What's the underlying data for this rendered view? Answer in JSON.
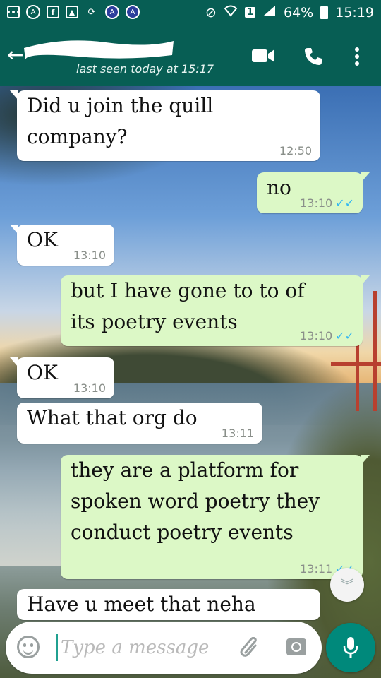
{
  "status_bar": {
    "sim_badge": "1",
    "battery": "64%",
    "time": "15:19",
    "icons": [
      "notification-icon",
      "app-icon",
      "facebook-icon",
      "gallery-icon",
      "sync-icon",
      "app-icon",
      "app-icon",
      "mute-icon",
      "wifi-icon",
      "signal-icon",
      "battery-icon"
    ]
  },
  "header": {
    "back_icon": "arrow-left-icon",
    "last_seen": "last seen today at 15:17",
    "actions": [
      "video-call-icon",
      "phone-icon",
      "more-vert-icon"
    ],
    "accent_color": "#075e54"
  },
  "messages": [
    {
      "dir": "in",
      "lines": [
        "Did u join the quill",
        "company?"
      ],
      "time": "12:50"
    },
    {
      "dir": "out",
      "lines": [
        "no"
      ],
      "time": "13:10",
      "status": "✓✓"
    },
    {
      "dir": "in",
      "lines": [
        "OK"
      ],
      "time": "13:10"
    },
    {
      "dir": "out",
      "lines": [
        "but I have gone to to of",
        "its poetry events"
      ],
      "time": "13:10",
      "status": "✓✓"
    },
    {
      "dir": "in",
      "lines": [
        "OK"
      ],
      "time": "13:10"
    },
    {
      "dir": "in",
      "lines": [
        "What that org do"
      ],
      "time": "13:11"
    },
    {
      "dir": "out",
      "lines": [
        "they are a platform for",
        "spoken word poetry they",
        "conduct poetry events"
      ],
      "time": "13:11",
      "status": "✓✓"
    },
    {
      "dir": "in",
      "lines": [
        "Have u meet that neha"
      ],
      "time": ""
    }
  ],
  "composer": {
    "placeholder": "Type a message",
    "icons": [
      "emoji-icon",
      "attach-icon",
      "camera-icon",
      "mic-icon"
    ],
    "mic_color": "#00897b"
  },
  "colors": {
    "incoming_bubble": "#ffffff",
    "outgoing_bubble": "#dcf8c6",
    "read_ticks": "#34b7f1"
  }
}
